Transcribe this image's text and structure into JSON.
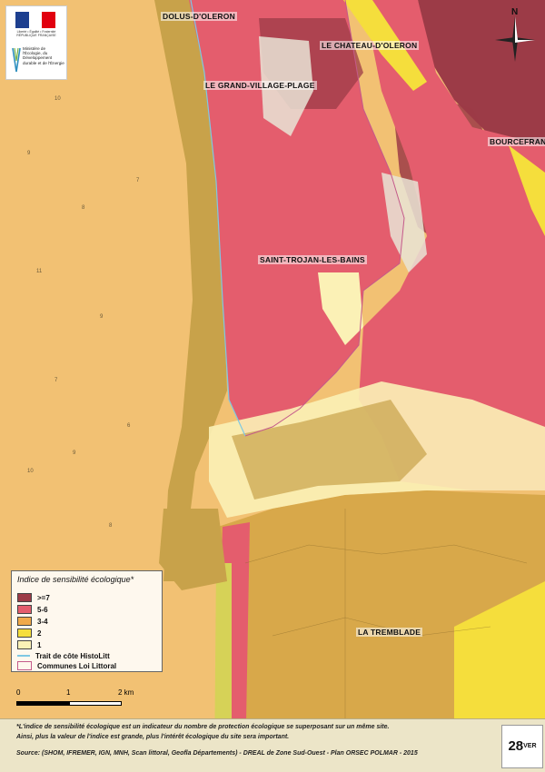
{
  "header": {
    "republic_text": "Liberté • Égalité • Fraternité RÉPUBLIQUE FRANÇAISE",
    "ministry": "Ministère de l'Écologie, du Développement durable et de l'Énergie"
  },
  "compass": {
    "north_label": "N"
  },
  "places": {
    "dolus": "DOLUS-D'OLERON",
    "chateau": "LE CHATEAU-D'OLERON",
    "grand_village": "LE GRAND-VILLAGE-PLAGE",
    "bourcefranc": "BOURCEFRAN",
    "saint_trojan": "SAINT-TROJAN-LES-BAINS",
    "tremblade": "LA TREMBLADE"
  },
  "legend": {
    "title": "Indice de sensibilité écologique*",
    "classes": [
      {
        "label": ">=7",
        "color": "#9c3b47"
      },
      {
        "label": "5-6",
        "color": "#e45d6d"
      },
      {
        "label": "3-4",
        "color": "#f0a94a"
      },
      {
        "label": "2",
        "color": "#f5de3c"
      },
      {
        "label": "1",
        "color": "#fbf1b6"
      }
    ],
    "coastline": {
      "label": "Trait de côte HistoLitt",
      "color": "#7ec8e3"
    },
    "communes": {
      "label": "Communes Loi Littoral",
      "color": "#c45a8a"
    }
  },
  "scale": {
    "labels": [
      "0",
      "1",
      "2 km"
    ]
  },
  "footer": {
    "note1": "*L'indice de sensibilité écologique est un indicateur du nombre de protection écologique se superposant sur un même site.",
    "note2": "Ainsi, plus la valeur de l'indice est grande, plus l'intérêt écologique du site sera important.",
    "source": "Source: (SHOM, IFREMER, IGN, MNH, Scan littoral, Geofla Départements) - DREAL de Zone Sud-Ouest - Plan ORSEC POLMAR - 2015",
    "page": "28",
    "page_suffix": "VER"
  },
  "colors": {
    "sea": "#f2c173",
    "dark_red": "#9c3b47",
    "red": "#e45d6d",
    "brown": "#c8a24a",
    "yellow": "#f5de3c"
  }
}
